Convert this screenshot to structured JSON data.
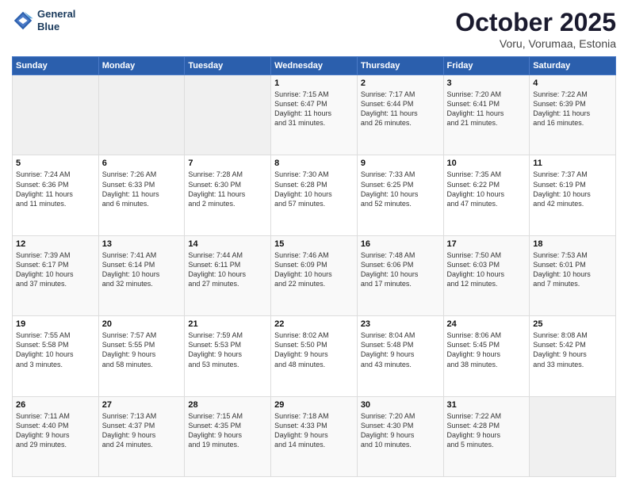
{
  "logo": {
    "line1": "General",
    "line2": "Blue"
  },
  "header": {
    "title": "October 2025",
    "subtitle": "Voru, Vorumaa, Estonia"
  },
  "weekdays": [
    "Sunday",
    "Monday",
    "Tuesday",
    "Wednesday",
    "Thursday",
    "Friday",
    "Saturday"
  ],
  "weeks": [
    [
      {
        "day": "",
        "info": ""
      },
      {
        "day": "",
        "info": ""
      },
      {
        "day": "",
        "info": ""
      },
      {
        "day": "1",
        "info": "Sunrise: 7:15 AM\nSunset: 6:47 PM\nDaylight: 11 hours\nand 31 minutes."
      },
      {
        "day": "2",
        "info": "Sunrise: 7:17 AM\nSunset: 6:44 PM\nDaylight: 11 hours\nand 26 minutes."
      },
      {
        "day": "3",
        "info": "Sunrise: 7:20 AM\nSunset: 6:41 PM\nDaylight: 11 hours\nand 21 minutes."
      },
      {
        "day": "4",
        "info": "Sunrise: 7:22 AM\nSunset: 6:39 PM\nDaylight: 11 hours\nand 16 minutes."
      }
    ],
    [
      {
        "day": "5",
        "info": "Sunrise: 7:24 AM\nSunset: 6:36 PM\nDaylight: 11 hours\nand 11 minutes."
      },
      {
        "day": "6",
        "info": "Sunrise: 7:26 AM\nSunset: 6:33 PM\nDaylight: 11 hours\nand 6 minutes."
      },
      {
        "day": "7",
        "info": "Sunrise: 7:28 AM\nSunset: 6:30 PM\nDaylight: 11 hours\nand 2 minutes."
      },
      {
        "day": "8",
        "info": "Sunrise: 7:30 AM\nSunset: 6:28 PM\nDaylight: 10 hours\nand 57 minutes."
      },
      {
        "day": "9",
        "info": "Sunrise: 7:33 AM\nSunset: 6:25 PM\nDaylight: 10 hours\nand 52 minutes."
      },
      {
        "day": "10",
        "info": "Sunrise: 7:35 AM\nSunset: 6:22 PM\nDaylight: 10 hours\nand 47 minutes."
      },
      {
        "day": "11",
        "info": "Sunrise: 7:37 AM\nSunset: 6:19 PM\nDaylight: 10 hours\nand 42 minutes."
      }
    ],
    [
      {
        "day": "12",
        "info": "Sunrise: 7:39 AM\nSunset: 6:17 PM\nDaylight: 10 hours\nand 37 minutes."
      },
      {
        "day": "13",
        "info": "Sunrise: 7:41 AM\nSunset: 6:14 PM\nDaylight: 10 hours\nand 32 minutes."
      },
      {
        "day": "14",
        "info": "Sunrise: 7:44 AM\nSunset: 6:11 PM\nDaylight: 10 hours\nand 27 minutes."
      },
      {
        "day": "15",
        "info": "Sunrise: 7:46 AM\nSunset: 6:09 PM\nDaylight: 10 hours\nand 22 minutes."
      },
      {
        "day": "16",
        "info": "Sunrise: 7:48 AM\nSunset: 6:06 PM\nDaylight: 10 hours\nand 17 minutes."
      },
      {
        "day": "17",
        "info": "Sunrise: 7:50 AM\nSunset: 6:03 PM\nDaylight: 10 hours\nand 12 minutes."
      },
      {
        "day": "18",
        "info": "Sunrise: 7:53 AM\nSunset: 6:01 PM\nDaylight: 10 hours\nand 7 minutes."
      }
    ],
    [
      {
        "day": "19",
        "info": "Sunrise: 7:55 AM\nSunset: 5:58 PM\nDaylight: 10 hours\nand 3 minutes."
      },
      {
        "day": "20",
        "info": "Sunrise: 7:57 AM\nSunset: 5:55 PM\nDaylight: 9 hours\nand 58 minutes."
      },
      {
        "day": "21",
        "info": "Sunrise: 7:59 AM\nSunset: 5:53 PM\nDaylight: 9 hours\nand 53 minutes."
      },
      {
        "day": "22",
        "info": "Sunrise: 8:02 AM\nSunset: 5:50 PM\nDaylight: 9 hours\nand 48 minutes."
      },
      {
        "day": "23",
        "info": "Sunrise: 8:04 AM\nSunset: 5:48 PM\nDaylight: 9 hours\nand 43 minutes."
      },
      {
        "day": "24",
        "info": "Sunrise: 8:06 AM\nSunset: 5:45 PM\nDaylight: 9 hours\nand 38 minutes."
      },
      {
        "day": "25",
        "info": "Sunrise: 8:08 AM\nSunset: 5:42 PM\nDaylight: 9 hours\nand 33 minutes."
      }
    ],
    [
      {
        "day": "26",
        "info": "Sunrise: 7:11 AM\nSunset: 4:40 PM\nDaylight: 9 hours\nand 29 minutes."
      },
      {
        "day": "27",
        "info": "Sunrise: 7:13 AM\nSunset: 4:37 PM\nDaylight: 9 hours\nand 24 minutes."
      },
      {
        "day": "28",
        "info": "Sunrise: 7:15 AM\nSunset: 4:35 PM\nDaylight: 9 hours\nand 19 minutes."
      },
      {
        "day": "29",
        "info": "Sunrise: 7:18 AM\nSunset: 4:33 PM\nDaylight: 9 hours\nand 14 minutes."
      },
      {
        "day": "30",
        "info": "Sunrise: 7:20 AM\nSunset: 4:30 PM\nDaylight: 9 hours\nand 10 minutes."
      },
      {
        "day": "31",
        "info": "Sunrise: 7:22 AM\nSunset: 4:28 PM\nDaylight: 9 hours\nand 5 minutes."
      },
      {
        "day": "",
        "info": ""
      }
    ]
  ]
}
